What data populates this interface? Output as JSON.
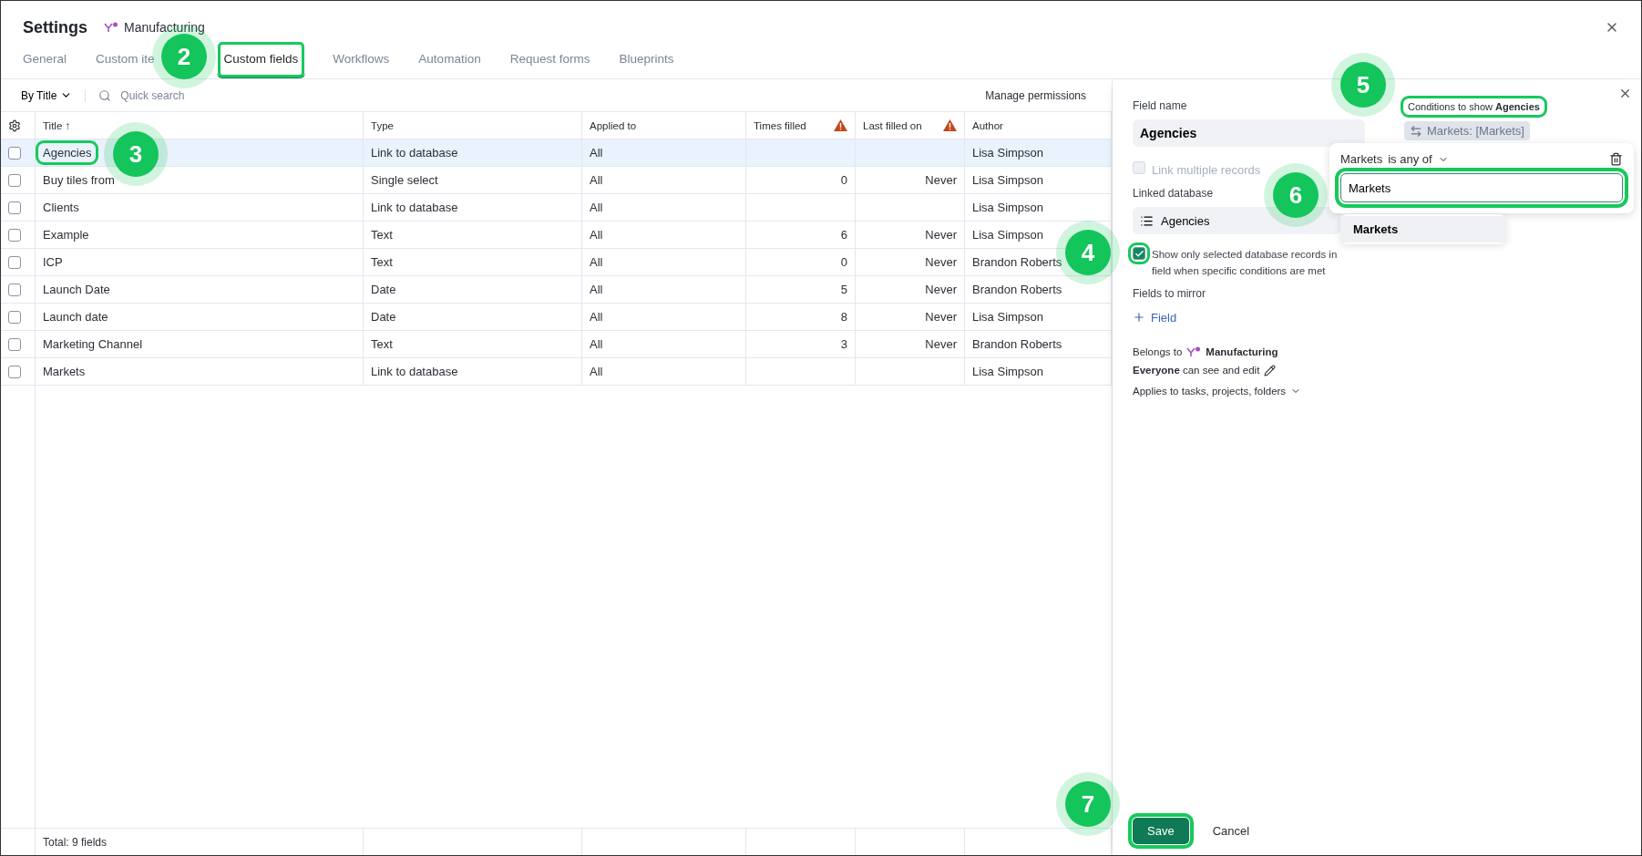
{
  "header": {
    "title": "Settings",
    "space": "Manufacturing"
  },
  "tabs": [
    {
      "label": "General",
      "selected": false,
      "highlighted": false
    },
    {
      "label": "Custom ite",
      "selected": false,
      "highlighted": false
    },
    {
      "label": "Custom fields",
      "selected": true,
      "highlighted": true
    },
    {
      "label": "Workflows",
      "selected": false,
      "highlighted": false
    },
    {
      "label": "Automation",
      "selected": false,
      "highlighted": false
    },
    {
      "label": "Request forms",
      "selected": false,
      "highlighted": false
    },
    {
      "label": "Blueprints",
      "selected": false,
      "highlighted": false
    }
  ],
  "toolbar": {
    "sort": "By Title",
    "search_placeholder": "Quick search",
    "permissions": "Manage permissions"
  },
  "table": {
    "columns": [
      {
        "label": "Title ↑",
        "warning": false
      },
      {
        "label": "Type",
        "warning": false
      },
      {
        "label": "Applied to",
        "warning": false
      },
      {
        "label": "Times filled",
        "warning": true
      },
      {
        "label": "Last filled on",
        "warning": true
      },
      {
        "label": "Author",
        "warning": false
      }
    ],
    "rows": [
      {
        "checked": false,
        "selected": true,
        "highlighted": true,
        "cells": [
          "Agencies",
          "Link to database",
          "All",
          "",
          "",
          "Lisa Simpson"
        ]
      },
      {
        "checked": false,
        "selected": false,
        "highlighted": false,
        "cells": [
          "Buy tiles from",
          "Single select",
          "All",
          "0",
          "Never",
          "Lisa Simpson"
        ]
      },
      {
        "checked": false,
        "selected": false,
        "highlighted": false,
        "cells": [
          "Clients",
          "Link to database",
          "All",
          "",
          "",
          "Lisa Simpson"
        ]
      },
      {
        "checked": false,
        "selected": false,
        "highlighted": false,
        "cells": [
          "Example",
          "Text",
          "All",
          "6",
          "Never",
          "Lisa Simpson"
        ]
      },
      {
        "checked": false,
        "selected": false,
        "highlighted": false,
        "cells": [
          "ICP",
          "Text",
          "All",
          "0",
          "Never",
          "Brandon Roberts"
        ]
      },
      {
        "checked": false,
        "selected": false,
        "highlighted": false,
        "cells": [
          "Launch Date",
          "Date",
          "All",
          "5",
          "Never",
          "Brandon Roberts"
        ]
      },
      {
        "checked": false,
        "selected": false,
        "highlighted": false,
        "cells": [
          "Launch date",
          "Date",
          "All",
          "8",
          "Never",
          "Lisa Simpson"
        ]
      },
      {
        "checked": false,
        "selected": false,
        "highlighted": false,
        "cells": [
          "Marketing Channel",
          "Text",
          "All",
          "3",
          "Never",
          "Brandon Roberts"
        ]
      },
      {
        "checked": false,
        "selected": false,
        "highlighted": false,
        "cells": [
          "Markets",
          "Link to database",
          "All",
          "",
          "",
          "Lisa Simpson"
        ]
      }
    ],
    "footer": "Total: 9 fields"
  },
  "panel": {
    "field_name_label": "Field name",
    "field_name": "Agencies",
    "link_multiple": {
      "label": "Link multiple records",
      "checked": false,
      "disabled": true
    },
    "linked_db_label": "Linked database",
    "linked_db": "Agencies",
    "show_selected": {
      "lines": [
        "Show only selected database records in",
        "field when specific conditions are met"
      ],
      "checked": true,
      "highlighted": true
    },
    "mirror_label": "Fields to mirror",
    "add_field": "Field",
    "belongs": "Belongs to",
    "belongs_space": "Manufacturing",
    "access": "**Everyone** can see and edit",
    "applies": "Applies to tasks, projects, folders",
    "conditions": {
      "title": "Conditions to show **Agencies**",
      "highlighted": true,
      "chip": "Markets: [Markets]",
      "popup": {
        "field": "Markets",
        "operator": "is any of",
        "input": "Markets",
        "input_highlighted": true,
        "options": [
          "Markets"
        ]
      }
    },
    "save": {
      "label": "Save",
      "highlighted": true
    },
    "cancel": "Cancel"
  },
  "callouts": [
    "2",
    "3",
    "4",
    "5",
    "6",
    "7"
  ]
}
